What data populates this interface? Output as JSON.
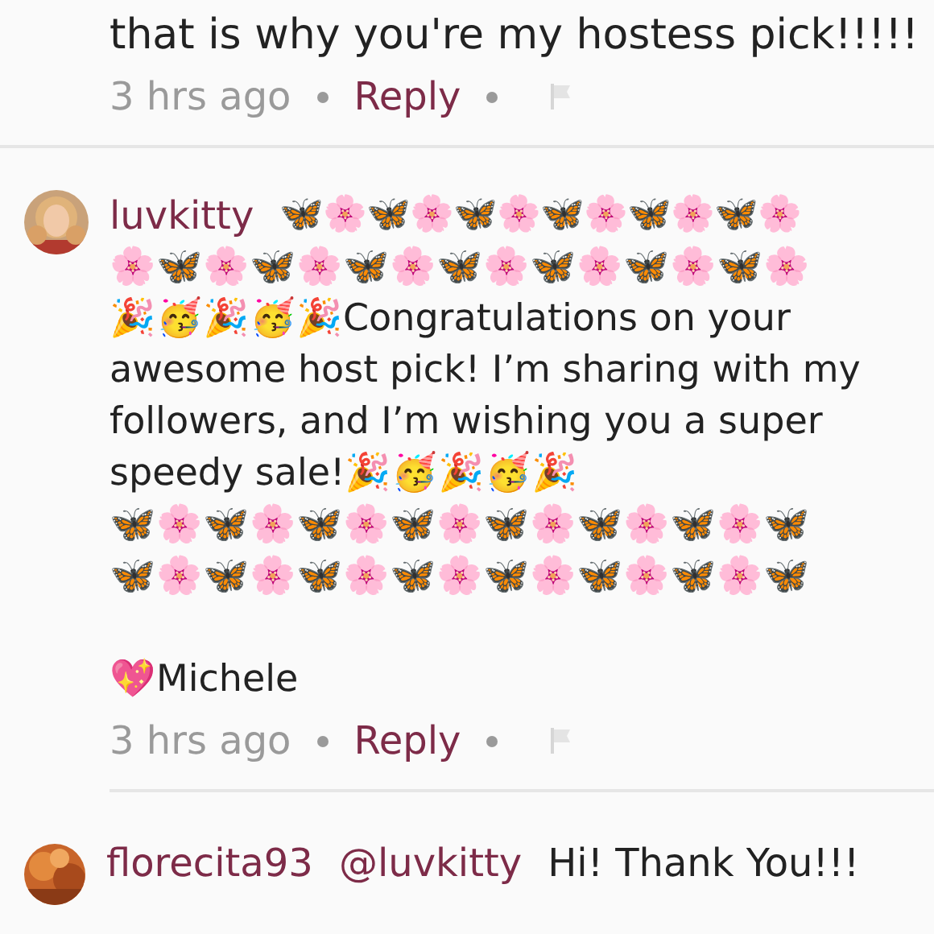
{
  "comments": [
    {
      "kind": "partial",
      "body": [
        "that is why you're my hostess pick!!!!!"
      ],
      "time": "3 hrs ago",
      "reply": "Reply"
    },
    {
      "kind": "full",
      "user": "luvkitty",
      "headline": "🦋🌸🦋🌸🦋🌸🦋🌸🦋🌸🦋🌸",
      "body": [
        "🌸🦋🌸🦋🌸🦋🌸🦋🌸🦋🌸🦋🌸🦋🌸",
        "🎉🥳🎉🥳🎉Congratulations on your awesome host pick!  I’m sharing with my followers, and I’m wishing you a super speedy sale!🎉🥳🎉🥳🎉",
        "🦋🌸🦋🌸🦋🌸🦋🌸🦋🌸🦋🌸🦋🌸🦋",
        "🦋🌸🦋🌸🦋🌸🦋🌸🦋🌸🦋🌸🦋🌸🦋"
      ],
      "signature": "💖Michele",
      "time": "3 hrs ago",
      "reply": "Reply"
    },
    {
      "kind": "last",
      "user": "florecita93",
      "mention": "@luvkitty",
      "body": [
        "Hi! Thank You!!!"
      ]
    }
  ]
}
